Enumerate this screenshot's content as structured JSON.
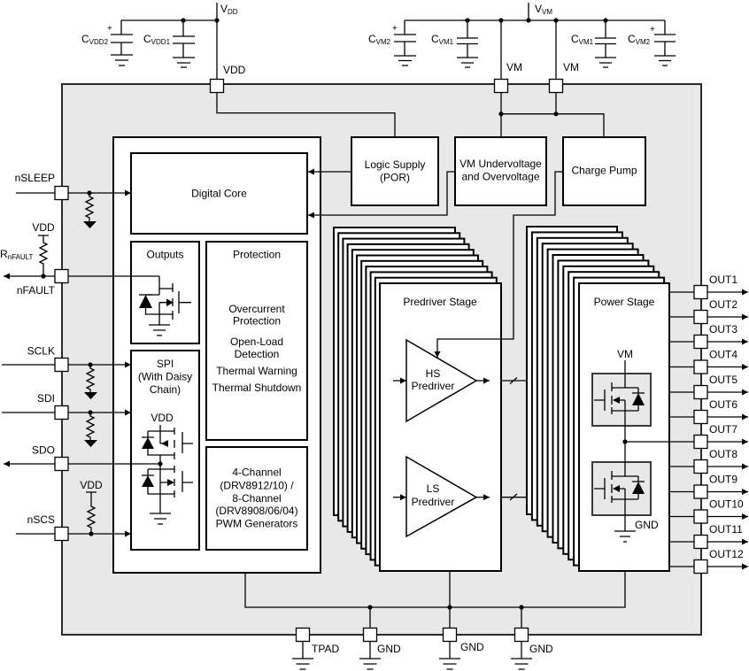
{
  "supply": {
    "vdd_net": {
      "symbol": "V",
      "subscript": "DD"
    },
    "vm_net": {
      "symbol": "V",
      "subscript": "VM"
    },
    "capacitors": [
      {
        "symbol": "C",
        "subscript": "VDD2",
        "polarity_mark": "+"
      },
      {
        "symbol": "C",
        "subscript": "VDD1"
      },
      {
        "symbol": "C",
        "subscript": "VM2",
        "polarity_mark": "+"
      },
      {
        "symbol": "C",
        "subscript": "VM1"
      },
      {
        "symbol": "C",
        "subscript": "VM1"
      },
      {
        "symbol": "C",
        "subscript": "VM2",
        "polarity_mark": "+"
      }
    ]
  },
  "pins": {
    "top": [
      "VDD",
      "VM",
      "VM"
    ],
    "left": [
      "nSLEEP",
      "nFAULT",
      "SCLK",
      "SDI",
      "SDO",
      "nSCS"
    ],
    "right": [
      "OUT1",
      "OUT2",
      "OUT3",
      "OUT4",
      "OUT5",
      "OUT6",
      "OUT7",
      "OUT8",
      "OUT9",
      "OUT10",
      "OUT11",
      "OUT12"
    ],
    "bottom": [
      "TPAD",
      "GND",
      "GND",
      "GND"
    ]
  },
  "external_components": {
    "r_nfault": {
      "symbol": "R",
      "subscript": "nFAULT"
    },
    "nfault_pullup_supply": "VDD",
    "nscs_pullup_supply": "VDD"
  },
  "blocks": {
    "logic_supply": {
      "lines": [
        "Logic Supply",
        "(POR)"
      ]
    },
    "vm_monitor": {
      "lines": [
        "VM Undervoltage",
        "and Overvoltage"
      ]
    },
    "charge_pump": {
      "label": "Charge Pump"
    },
    "digital_core": {
      "label": "Digital Core"
    },
    "outputs": {
      "title": "Outputs"
    },
    "protection": {
      "title": "Protection",
      "lines": [
        "Overcurrent",
        "Protection",
        "Open-Load",
        "Detection",
        "Thermal Warning",
        "Thermal Shutdown"
      ]
    },
    "spi": {
      "lines": [
        "SPI",
        "(With Daisy",
        "Chain)"
      ],
      "supply": "VDD"
    },
    "pwm": {
      "lines": [
        "4-Channel",
        "(DRV8912/10) /",
        "8-Channel",
        "(DRV8908/06/04)",
        "PWM Generators"
      ]
    },
    "predriver_stage": {
      "title": "Predriver Stage",
      "hs": [
        "HS",
        "Predriver"
      ],
      "ls": [
        "LS",
        "Predriver"
      ]
    },
    "power_stage": {
      "title": "Power Stage",
      "supply": "VM",
      "ground": "GND"
    }
  },
  "colors": {
    "device_fill": "#e8e8e8",
    "block_fill": "#ffffff",
    "line": "#000000"
  }
}
